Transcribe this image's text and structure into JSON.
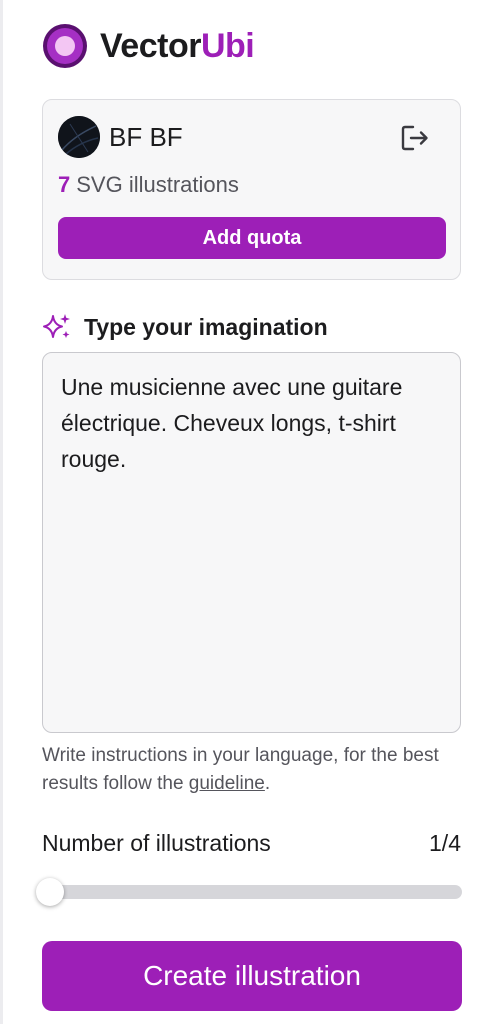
{
  "brand": {
    "name_part1": "Vector",
    "name_part2": "Ubi",
    "accent_color": "#9d1fb7"
  },
  "account": {
    "user_name": "BF BF",
    "avatar_icon": "avatar-image",
    "logout_icon": "logout-icon",
    "credits_count": "7",
    "credits_label": "SVG illustrations",
    "add_quota_label": "Add quota"
  },
  "prompt": {
    "icon": "sparkles-icon",
    "label": "Type your imagination",
    "value": "Une musicienne avec une guitare électrique. Cheveux longs, t-shirt rouge."
  },
  "hint": {
    "text_before": "Write instructions in your language, for the best results follow the ",
    "link_text": "guideline",
    "text_after": "."
  },
  "illustrations": {
    "label": "Number of illustrations",
    "value_display": "1/4",
    "current": 1,
    "min": 1,
    "max": 4
  },
  "create_button_label": "Create illustration"
}
